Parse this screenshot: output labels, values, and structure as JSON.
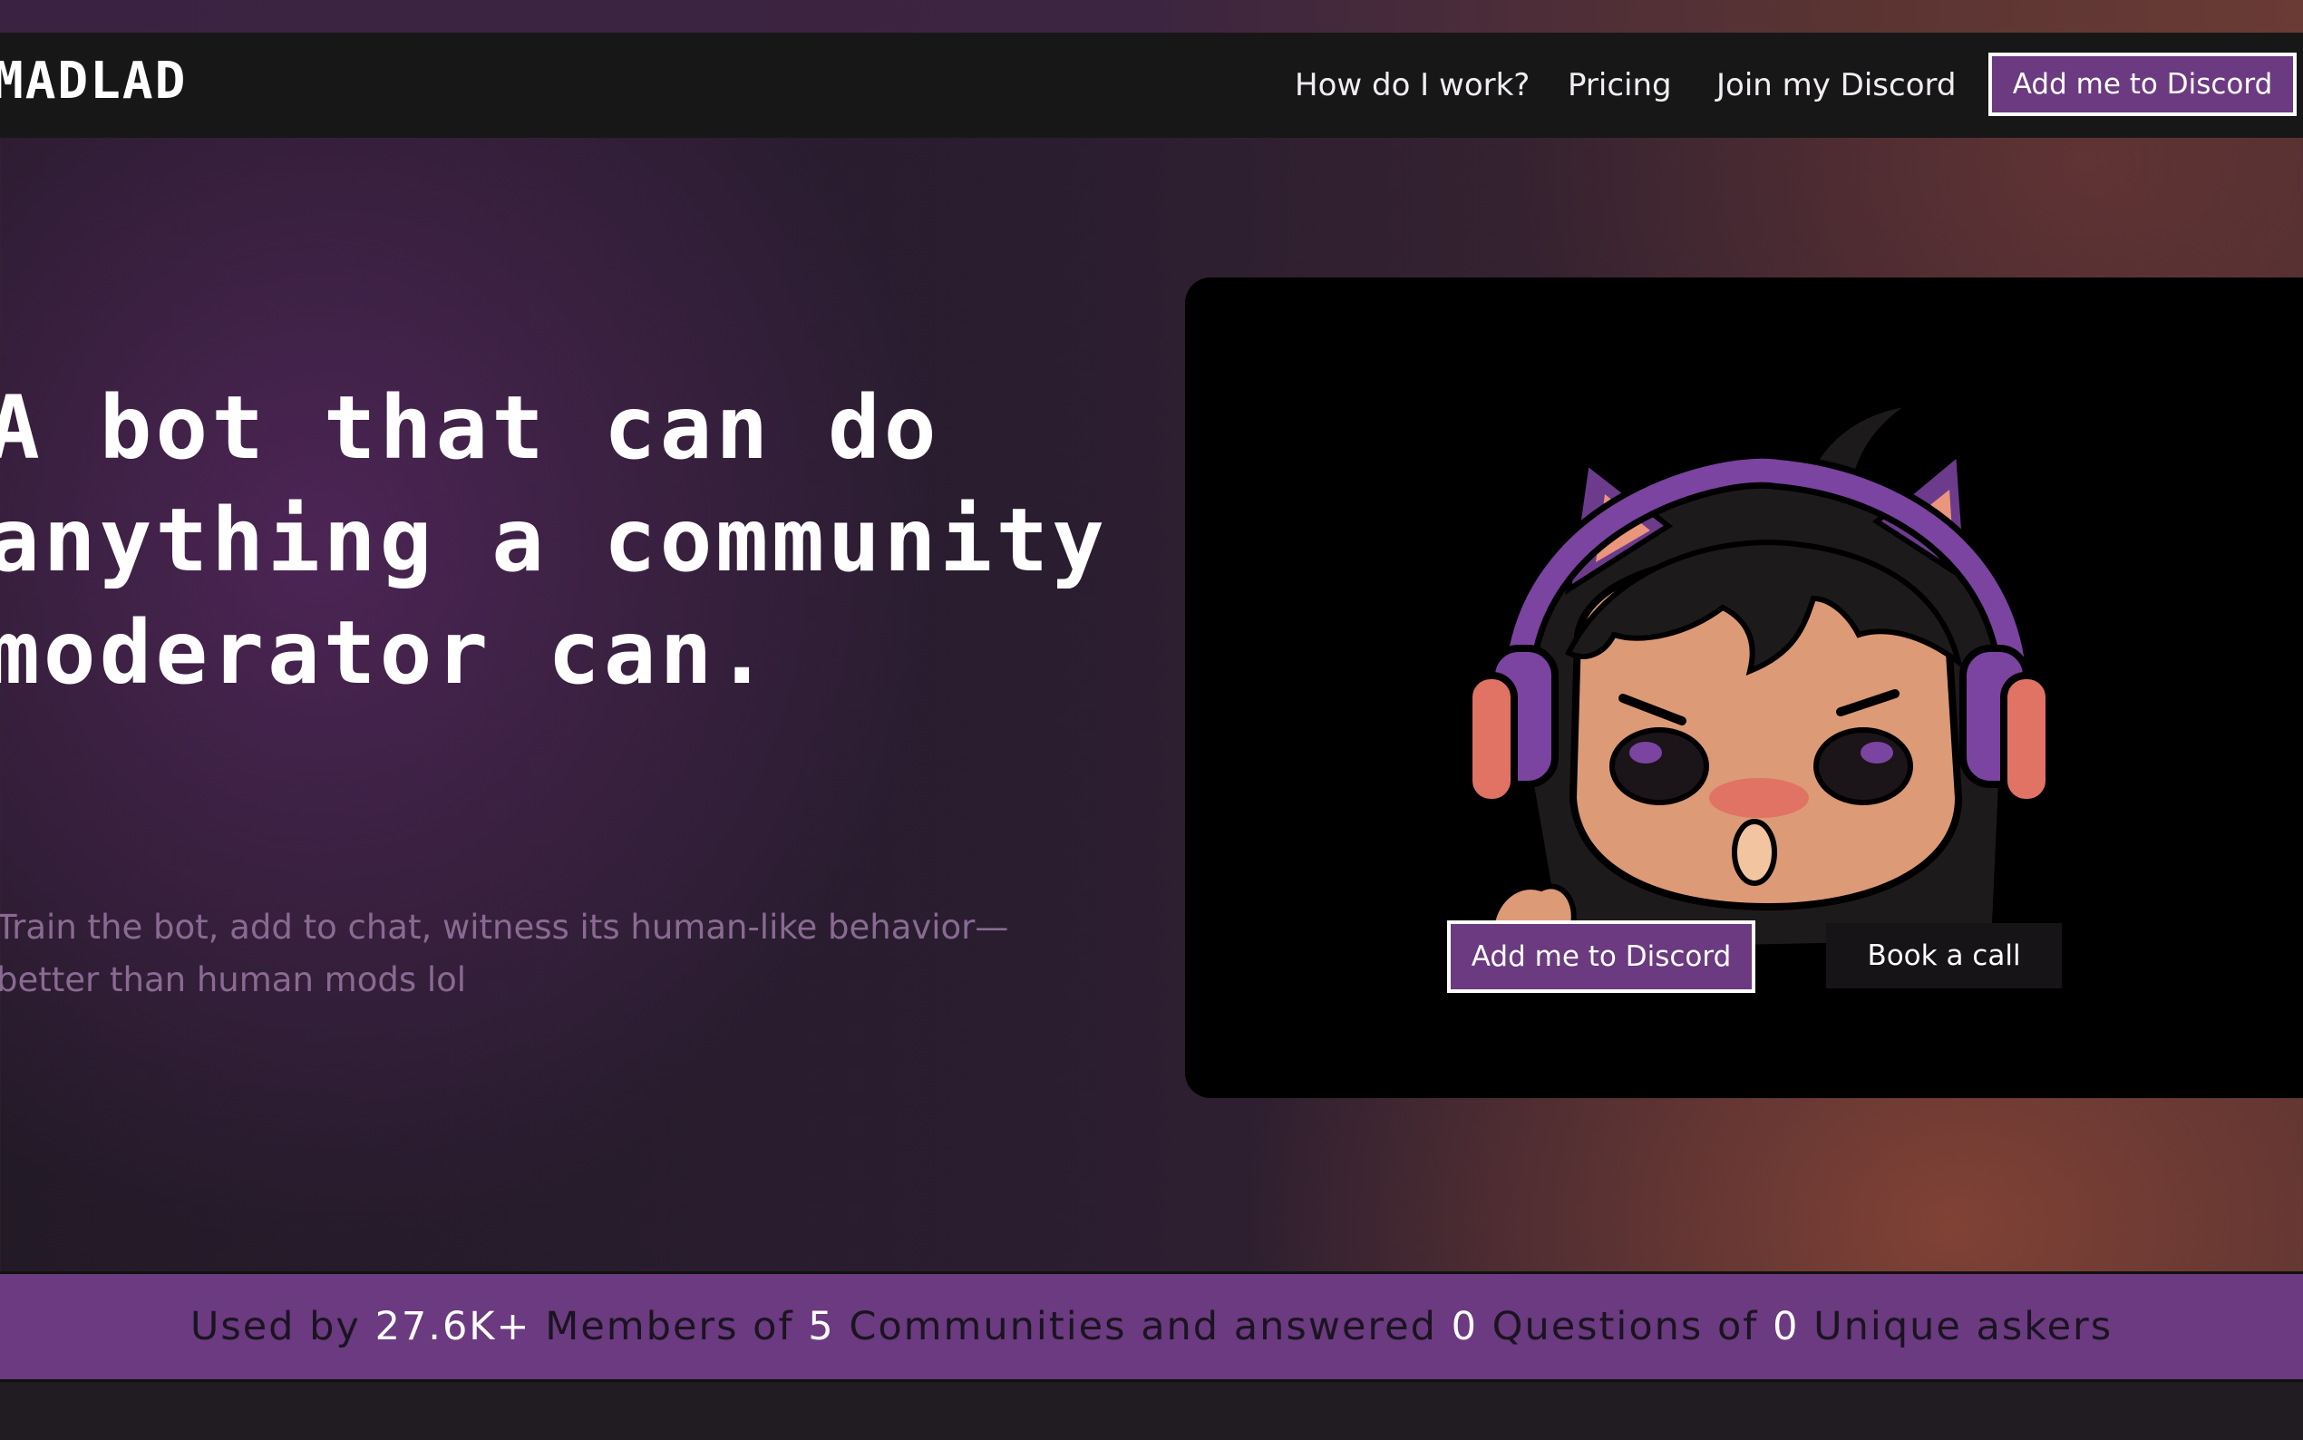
{
  "brand": {
    "logo_text": "MADLAD"
  },
  "nav": {
    "links": [
      "How do I work?",
      "Pricing",
      "Join my Discord"
    ],
    "cta": "Add me to Discord"
  },
  "hero": {
    "headline": "A bot that can do anything a community moderator can.",
    "subtext": "Train the bot, add to chat, witness its human-like behavior—better than human mods lol",
    "primary_button": "Add me to Discord",
    "secondary_button": "Book a call",
    "image": "headphone-cat-ear-mascot"
  },
  "stats": {
    "prefix": "Used by",
    "members": "27.6K+",
    "members_label": "Members of",
    "communities": "5",
    "communities_label": "Communities and answered",
    "questions": "0",
    "questions_label": "Questions of",
    "askers": "0",
    "askers_label": "Unique askers"
  },
  "colors": {
    "accent_purple": "#6b3a80",
    "navbar_bg": "#181718",
    "card_bg": "#000000",
    "subtext": "#8a6a93"
  }
}
